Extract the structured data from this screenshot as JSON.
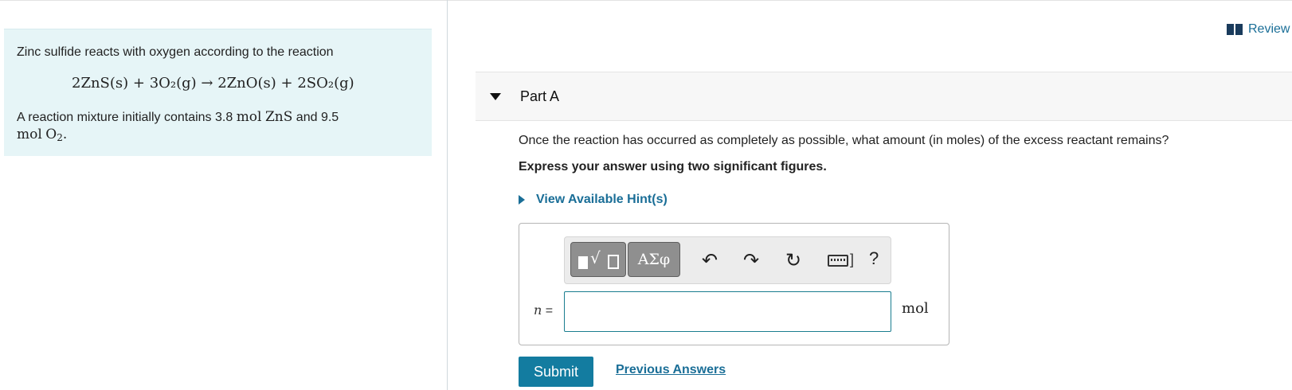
{
  "problem": {
    "intro": "Zinc sulfide reacts with oxygen according to the reaction",
    "equation": "2ZnS(s) + 3O₂(g) → 2ZnO(s) + 2SO₂(g)",
    "mixture": {
      "prefix": "A reaction mixture initially contains 3.8 ",
      "qty1_unit": "mol",
      "qty1_species": "ZnS",
      "middle": " and 9.5",
      "qty2_unit": "mol",
      "qty2_species_base": "O",
      "qty2_species_sub": "2",
      "suffix": "."
    }
  },
  "review": {
    "label": "Review",
    "icon": "book-icon"
  },
  "part": {
    "title": "Part A",
    "question": "Once the reaction has occurred as completely as possible, what amount (in moles) of the excess reactant remains?",
    "instruction": "Express your answer using two significant figures.",
    "hint_label": "View Available Hint(s)"
  },
  "toolbar": {
    "greek_label": "ΑΣφ",
    "icons": [
      "templates-icon",
      "greek-symbols-icon",
      "undo-icon",
      "redo-icon",
      "reset-icon",
      "keyboard-icon",
      "help-icon"
    ],
    "help_label": "?"
  },
  "answer": {
    "variable": "n",
    "equals": " =",
    "value": "",
    "unit": "mol"
  },
  "actions": {
    "submit_label": "Submit",
    "previous_label": "Previous Answers"
  },
  "colors": {
    "problem_bg": "#e6f5f7",
    "link": "#1a6e97",
    "submit_bg": "#137ca0",
    "input_border": "#1a7d8f"
  }
}
